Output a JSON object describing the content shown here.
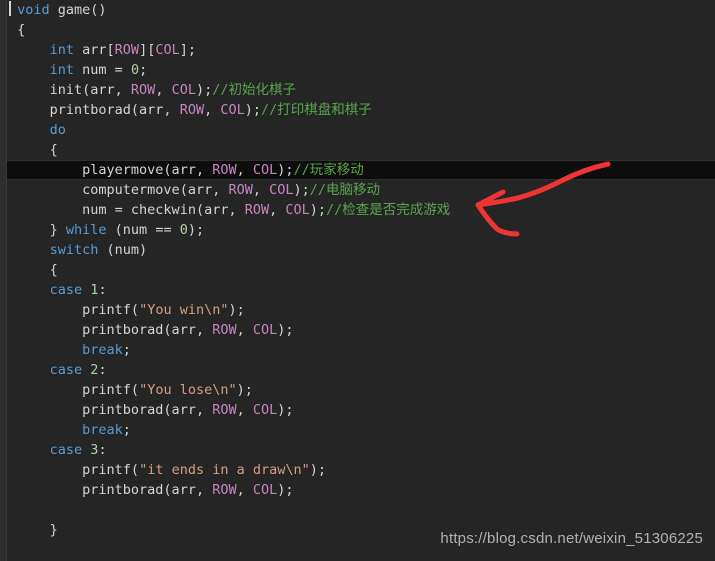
{
  "editor": {
    "name": "code-editor",
    "background_color": "#252526",
    "gutter_color": "#2d2d30",
    "highlight_color": "#0d0d0d",
    "default_text_color": "#d4d4d4",
    "keyword_color": "#569cd6",
    "macro_color": "#c586c0",
    "comment_color": "#57a64a",
    "string_color": "#d69d85",
    "number_color": "#b5cea8",
    "highlighted_line_index": 8,
    "caret_line_index": 0,
    "language": "C"
  },
  "lines": [
    {
      "indent": 0,
      "tokens": [
        {
          "t": "void",
          "c": "kw"
        },
        {
          "t": " ",
          "c": "plain"
        },
        {
          "t": "game()",
          "c": "plain"
        }
      ]
    },
    {
      "indent": 0,
      "tokens": [
        {
          "t": "{",
          "c": "punc"
        }
      ]
    },
    {
      "indent": 1,
      "tokens": [
        {
          "t": "int",
          "c": "kw"
        },
        {
          "t": " arr[",
          "c": "plain"
        },
        {
          "t": "ROW",
          "c": "mac"
        },
        {
          "t": "][",
          "c": "plain"
        },
        {
          "t": "COL",
          "c": "mac"
        },
        {
          "t": "];",
          "c": "plain"
        }
      ]
    },
    {
      "indent": 1,
      "tokens": [
        {
          "t": "int",
          "c": "kw"
        },
        {
          "t": " num = ",
          "c": "plain"
        },
        {
          "t": "0",
          "c": "num"
        },
        {
          "t": ";",
          "c": "plain"
        }
      ]
    },
    {
      "indent": 1,
      "tokens": [
        {
          "t": "init(arr, ",
          "c": "plain"
        },
        {
          "t": "ROW",
          "c": "mac"
        },
        {
          "t": ", ",
          "c": "plain"
        },
        {
          "t": "COL",
          "c": "mac"
        },
        {
          "t": ");",
          "c": "plain"
        },
        {
          "t": "//初始化棋子",
          "c": "cmt"
        }
      ]
    },
    {
      "indent": 1,
      "tokens": [
        {
          "t": "printborad(arr, ",
          "c": "plain"
        },
        {
          "t": "ROW",
          "c": "mac"
        },
        {
          "t": ", ",
          "c": "plain"
        },
        {
          "t": "COL",
          "c": "mac"
        },
        {
          "t": ");",
          "c": "plain"
        },
        {
          "t": "//打印棋盘和棋子",
          "c": "cmt"
        }
      ]
    },
    {
      "indent": 1,
      "tokens": [
        {
          "t": "do",
          "c": "kw"
        }
      ]
    },
    {
      "indent": 1,
      "tokens": [
        {
          "t": "{",
          "c": "punc"
        }
      ]
    },
    {
      "indent": 2,
      "tokens": [
        {
          "t": "playermove(arr, ",
          "c": "plain"
        },
        {
          "t": "ROW",
          "c": "mac"
        },
        {
          "t": ", ",
          "c": "plain"
        },
        {
          "t": "COL",
          "c": "mac"
        },
        {
          "t": ");",
          "c": "plain"
        },
        {
          "t": "//玩家移动",
          "c": "cmt"
        }
      ]
    },
    {
      "indent": 2,
      "tokens": [
        {
          "t": "computermove(arr, ",
          "c": "plain"
        },
        {
          "t": "ROW",
          "c": "mac"
        },
        {
          "t": ", ",
          "c": "plain"
        },
        {
          "t": "COL",
          "c": "mac"
        },
        {
          "t": ");",
          "c": "plain"
        },
        {
          "t": "//电脑移动",
          "c": "cmt"
        }
      ]
    },
    {
      "indent": 2,
      "tokens": [
        {
          "t": "num = checkwin(arr, ",
          "c": "plain"
        },
        {
          "t": "ROW",
          "c": "mac"
        },
        {
          "t": ", ",
          "c": "plain"
        },
        {
          "t": "COL",
          "c": "mac"
        },
        {
          "t": ");",
          "c": "plain"
        },
        {
          "t": "//检查是否完成游戏",
          "c": "cmt"
        }
      ]
    },
    {
      "indent": 1,
      "tokens": [
        {
          "t": "} ",
          "c": "punc"
        },
        {
          "t": "while",
          "c": "kw"
        },
        {
          "t": " (num == ",
          "c": "plain"
        },
        {
          "t": "0",
          "c": "num"
        },
        {
          "t": ");",
          "c": "plain"
        }
      ]
    },
    {
      "indent": 1,
      "tokens": [
        {
          "t": "switch",
          "c": "kw"
        },
        {
          "t": " (num)",
          "c": "plain"
        }
      ]
    },
    {
      "indent": 1,
      "tokens": [
        {
          "t": "{",
          "c": "punc"
        }
      ]
    },
    {
      "indent": 1,
      "tokens": [
        {
          "t": "case",
          "c": "kw"
        },
        {
          "t": " ",
          "c": "plain"
        },
        {
          "t": "1",
          "c": "num"
        },
        {
          "t": ":",
          "c": "plain"
        }
      ]
    },
    {
      "indent": 2,
      "tokens": [
        {
          "t": "printf(",
          "c": "plain"
        },
        {
          "t": "\"You win\\n\"",
          "c": "str"
        },
        {
          "t": ");",
          "c": "plain"
        }
      ]
    },
    {
      "indent": 2,
      "tokens": [
        {
          "t": "printborad(arr, ",
          "c": "plain"
        },
        {
          "t": "ROW",
          "c": "mac"
        },
        {
          "t": ", ",
          "c": "plain"
        },
        {
          "t": "COL",
          "c": "mac"
        },
        {
          "t": ");",
          "c": "plain"
        }
      ]
    },
    {
      "indent": 2,
      "tokens": [
        {
          "t": "break",
          "c": "kw"
        },
        {
          "t": ";",
          "c": "plain"
        }
      ]
    },
    {
      "indent": 1,
      "tokens": [
        {
          "t": "case",
          "c": "kw"
        },
        {
          "t": " ",
          "c": "plain"
        },
        {
          "t": "2",
          "c": "num"
        },
        {
          "t": ":",
          "c": "plain"
        }
      ]
    },
    {
      "indent": 2,
      "tokens": [
        {
          "t": "printf(",
          "c": "plain"
        },
        {
          "t": "\"You lose\\n\"",
          "c": "str"
        },
        {
          "t": ");",
          "c": "plain"
        }
      ]
    },
    {
      "indent": 2,
      "tokens": [
        {
          "t": "printborad(arr, ",
          "c": "plain"
        },
        {
          "t": "ROW",
          "c": "mac"
        },
        {
          "t": ", ",
          "c": "plain"
        },
        {
          "t": "COL",
          "c": "mac"
        },
        {
          "t": ");",
          "c": "plain"
        }
      ]
    },
    {
      "indent": 2,
      "tokens": [
        {
          "t": "break",
          "c": "kw"
        },
        {
          "t": ";",
          "c": "plain"
        }
      ]
    },
    {
      "indent": 1,
      "tokens": [
        {
          "t": "case",
          "c": "kw"
        },
        {
          "t": " ",
          "c": "plain"
        },
        {
          "t": "3",
          "c": "num"
        },
        {
          "t": ":",
          "c": "plain"
        }
      ]
    },
    {
      "indent": 2,
      "tokens": [
        {
          "t": "printf(",
          "c": "plain"
        },
        {
          "t": "\"it ends in a draw\\n\"",
          "c": "str"
        },
        {
          "t": ");",
          "c": "plain"
        }
      ]
    },
    {
      "indent": 2,
      "tokens": [
        {
          "t": "printborad(arr, ",
          "c": "plain"
        },
        {
          "t": "ROW",
          "c": "mac"
        },
        {
          "t": ", ",
          "c": "plain"
        },
        {
          "t": "COL",
          "c": "mac"
        },
        {
          "t": ");",
          "c": "plain"
        }
      ]
    },
    {
      "indent": 0,
      "tokens": []
    },
    {
      "indent": 1,
      "tokens": [
        {
          "t": "}",
          "c": "punc"
        }
      ]
    },
    {
      "indent": 0,
      "tokens": []
    }
  ],
  "annotation": {
    "name": "red-arrow",
    "color": "#ef3434",
    "description": "hand-drawn red arrow pointing left toward the computermove line"
  },
  "watermark": {
    "text": "https://blog.csdn.net/weixin_51306225",
    "color": "#bfbfbf"
  }
}
